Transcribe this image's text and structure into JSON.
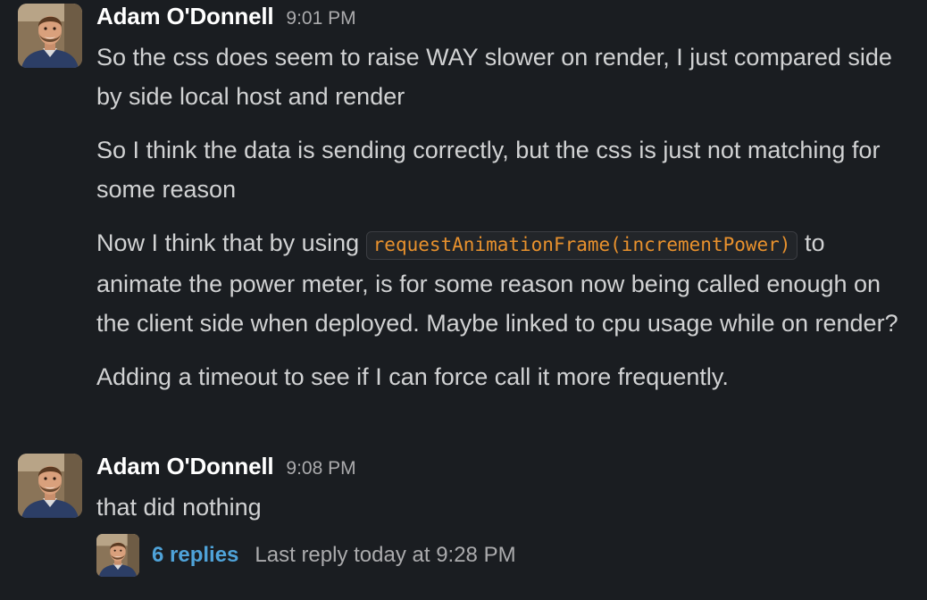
{
  "messages": [
    {
      "author": "Adam O'Donnell",
      "time": "9:01 PM",
      "paragraphs": [
        {
          "text": "So the css does seem to raise WAY slower on render, I just compared side by side local host and render"
        },
        {
          "text": "So I think the data is sending correctly, but the css is just not matching for some reason"
        },
        {
          "before": "Now I think that by using ",
          "code": "requestAnimationFrame(incrementPower)",
          "after": " to animate the power meter, is for some reason now being called enough on the client side when deployed. Maybe linked to cpu usage while on render?"
        },
        {
          "text": "Adding a timeout to see if I can force call it more frequently."
        }
      ]
    },
    {
      "author": "Adam O'Donnell",
      "time": "9:08 PM",
      "paragraphs": [
        {
          "text": "that did nothing"
        }
      ],
      "thread": {
        "replies": "6 replies",
        "last_reply": "Last reply today at 9:28 PM"
      }
    }
  ],
  "colors": {
    "background": "#1a1d21",
    "text": "#d1d2d3",
    "author": "#ffffff",
    "timestamp": "#ababad",
    "code_text": "#e8912d",
    "link": "#4fa3d9"
  },
  "icons": [
    "avatar-photo"
  ]
}
